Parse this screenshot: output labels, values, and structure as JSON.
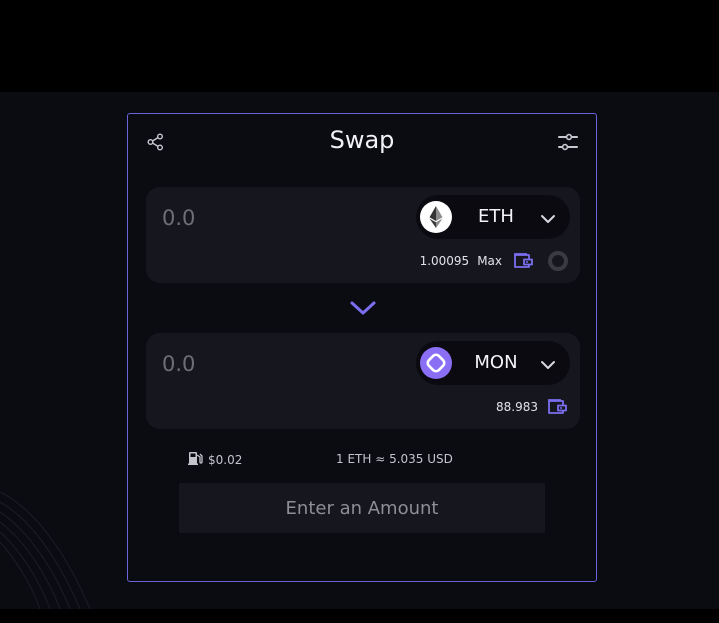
{
  "swap": {
    "title": "Swap",
    "from": {
      "amount_placeholder": "0.0",
      "token_symbol": "ETH",
      "balance": "1.00095",
      "max_label": "Max"
    },
    "to": {
      "amount_placeholder": "0.0",
      "token_symbol": "MON",
      "balance": "88.983"
    },
    "gas_fee": "$0.02",
    "rate": "1 ETH ≈ 5.035 USD",
    "cta_label": "Enter an Amount"
  },
  "colors": {
    "page_background": "#000000",
    "card_background": "#0b0b12",
    "card_border": "#6a63d9",
    "panel_background": "#16161e",
    "accent": "#7b6ff0",
    "mon_token": "#8a6ff5"
  },
  "icons": {
    "share": "share-icon",
    "settings": "sliders-icon",
    "eth_logo": "ethereum-logo-icon",
    "mon_logo": "monad-logo-icon",
    "chevron": "chevron-down-icon",
    "wallet": "wallet-icon",
    "spinner": "loading-spinner-icon",
    "swap_direction": "swap-arrow-down-icon",
    "gas": "gas-pump-icon"
  }
}
